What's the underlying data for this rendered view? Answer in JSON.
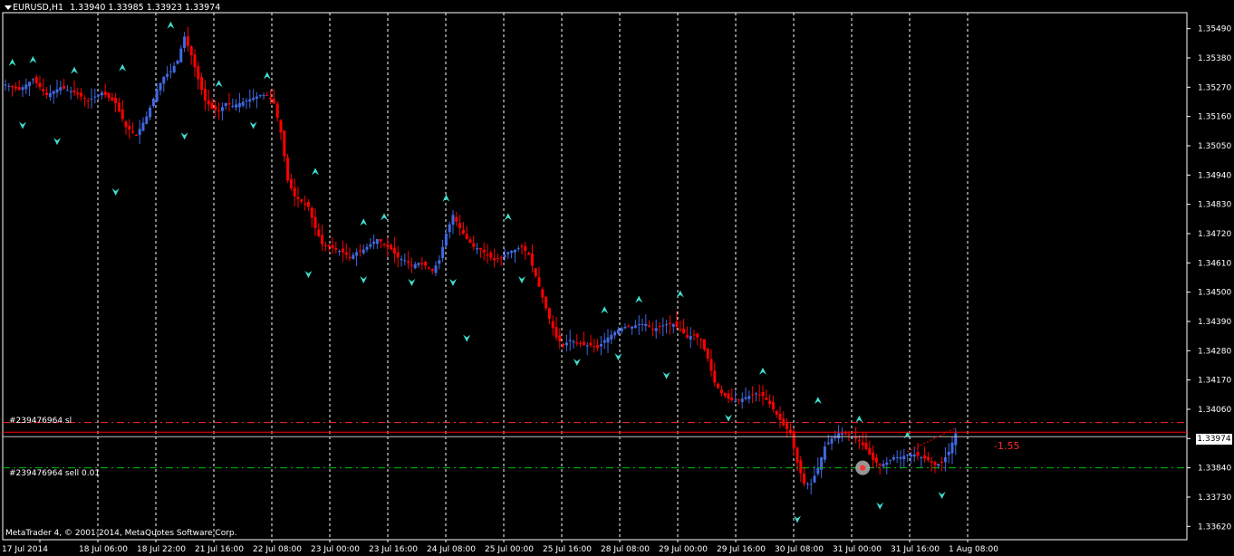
{
  "header": {
    "symbol": "EURUSD,H1",
    "ohlc": "1.33940 1.33985 1.33923 1.33974"
  },
  "copyright": "MetaTrader 4, © 2001-2014, MetaQuotes Software Corp.",
  "orders": {
    "sl_label": "#239476964 sl",
    "sell_label": "#239476964 sell 0.01",
    "sl_price": 1.3401,
    "sell_price": 1.3384,
    "profit": "-1.55"
  },
  "current_price": {
    "label": "1.33974",
    "value": 1.33974
  },
  "colors": {
    "bull": "#4169e1",
    "bear": "#ff0000",
    "fractal": "#40e0d0",
    "grid": "#ffffff",
    "sl_line": "#ff2a2a",
    "sell_line": "#00c000",
    "price_line": "#ff0000"
  },
  "chart_data": {
    "type": "candlestick",
    "title": "",
    "ylim": [
      1.3357,
      1.3555
    ],
    "y_ticks": [
      "1.35490",
      "1.35380",
      "1.35270",
      "1.35160",
      "1.35050",
      "1.34940",
      "1.34830",
      "1.34720",
      "1.34610",
      "1.34500",
      "1.34390",
      "1.34280",
      "1.34170",
      "1.34060",
      "1.33950",
      "1.33840",
      "1.33730",
      "1.33620"
    ],
    "x_ticks": [
      "17 Jul 2014",
      "18 Jul 06:00",
      "18 Jul 22:00",
      "21 Jul 16:00",
      "22 Jul 08:00",
      "23 Jul 00:00",
      "23 Jul 16:00",
      "24 Jul 08:00",
      "25 Jul 00:00",
      "25 Jul 16:00",
      "28 Jul 08:00",
      "29 Jul 00:00",
      "29 Jul 16:00",
      "30 Jul 08:00",
      "31 Jul 00:00",
      "31 Jul 16:00",
      "1 Aug 08:00"
    ],
    "close_path": [
      [
        0,
        1.3528
      ],
      [
        4,
        1.3526
      ],
      [
        8,
        1.353
      ],
      [
        12,
        1.3524
      ],
      [
        16,
        1.3527
      ],
      [
        20,
        1.3525
      ],
      [
        24,
        1.3522
      ],
      [
        28,
        1.3525
      ],
      [
        32,
        1.3521
      ],
      [
        35,
        1.3512
      ],
      [
        38,
        1.3509
      ],
      [
        41,
        1.3516
      ],
      [
        44,
        1.3526
      ],
      [
        46,
        1.3531
      ],
      [
        48,
        1.3533
      ],
      [
        50,
        1.3537
      ],
      [
        52,
        1.3546
      ],
      [
        54,
        1.3539
      ],
      [
        56,
        1.353
      ],
      [
        58,
        1.3522
      ],
      [
        60,
        1.3519
      ],
      [
        62,
        1.3518
      ],
      [
        64,
        1.3521
      ],
      [
        66,
        1.352
      ],
      [
        68,
        1.3521
      ],
      [
        70,
        1.3522
      ],
      [
        72,
        1.3523
      ],
      [
        74,
        1.3524
      ],
      [
        76,
        1.3524
      ],
      [
        78,
        1.3521
      ],
      [
        80,
        1.351
      ],
      [
        82,
        1.3492
      ],
      [
        84,
        1.3486
      ],
      [
        86,
        1.3484
      ],
      [
        88,
        1.3482
      ],
      [
        90,
        1.3474
      ],
      [
        92,
        1.3468
      ],
      [
        94,
        1.3467
      ],
      [
        96,
        1.3466
      ],
      [
        98,
        1.3465
      ],
      [
        100,
        1.3463
      ],
      [
        102,
        1.3465
      ],
      [
        104,
        1.3466
      ],
      [
        106,
        1.3468
      ],
      [
        108,
        1.347
      ],
      [
        110,
        1.3468
      ],
      [
        112,
        1.3466
      ],
      [
        114,
        1.3463
      ],
      [
        116,
        1.3462
      ],
      [
        118,
        1.346
      ],
      [
        120,
        1.3461
      ],
      [
        122,
        1.346
      ],
      [
        124,
        1.3458
      ],
      [
        126,
        1.3462
      ],
      [
        128,
        1.3472
      ],
      [
        130,
        1.3479
      ],
      [
        132,
        1.3474
      ],
      [
        134,
        1.347
      ],
      [
        136,
        1.3467
      ],
      [
        138,
        1.3466
      ],
      [
        140,
        1.3464
      ],
      [
        142,
        1.3462
      ],
      [
        144,
        1.3463
      ],
      [
        146,
        1.3465
      ],
      [
        148,
        1.3466
      ],
      [
        150,
        1.3467
      ],
      [
        152,
        1.3464
      ],
      [
        154,
        1.3456
      ],
      [
        156,
        1.3448
      ],
      [
        158,
        1.344
      ],
      [
        160,
        1.3433
      ],
      [
        162,
        1.343
      ],
      [
        164,
        1.3432
      ],
      [
        166,
        1.3431
      ],
      [
        168,
        1.343
      ],
      [
        170,
        1.343
      ],
      [
        172,
        1.3429
      ],
      [
        174,
        1.3432
      ],
      [
        176,
        1.3434
      ],
      [
        178,
        1.3436
      ],
      [
        180,
        1.3437
      ],
      [
        182,
        1.3437
      ],
      [
        184,
        1.3438
      ],
      [
        186,
        1.3438
      ],
      [
        188,
        1.3436
      ],
      [
        190,
        1.3437
      ],
      [
        192,
        1.3438
      ],
      [
        194,
        1.3438
      ],
      [
        196,
        1.3436
      ],
      [
        198,
        1.3433
      ],
      [
        200,
        1.3434
      ],
      [
        202,
        1.3432
      ],
      [
        204,
        1.3425
      ],
      [
        206,
        1.3416
      ],
      [
        208,
        1.3412
      ],
      [
        210,
        1.341
      ],
      [
        212,
        1.3409
      ],
      [
        214,
        1.341
      ],
      [
        216,
        1.3411
      ],
      [
        218,
        1.3412
      ],
      [
        220,
        1.3411
      ],
      [
        222,
        1.3408
      ],
      [
        224,
        1.3404
      ],
      [
        226,
        1.34
      ],
      [
        228,
        1.3397
      ],
      [
        230,
        1.3386
      ],
      [
        232,
        1.3378
      ],
      [
        234,
        1.3378
      ],
      [
        236,
        1.3384
      ],
      [
        238,
        1.3392
      ],
      [
        240,
        1.3395
      ],
      [
        242,
        1.3397
      ],
      [
        244,
        1.3397
      ],
      [
        246,
        1.3396
      ],
      [
        248,
        1.3394
      ],
      [
        250,
        1.3391
      ],
      [
        252,
        1.3387
      ],
      [
        254,
        1.3385
      ],
      [
        256,
        1.3386
      ],
      [
        258,
        1.3388
      ],
      [
        260,
        1.3388
      ],
      [
        262,
        1.3389
      ],
      [
        264,
        1.3389
      ],
      [
        266,
        1.3388
      ],
      [
        268,
        1.3387
      ],
      [
        270,
        1.3385
      ],
      [
        272,
        1.3386
      ],
      [
        274,
        1.339
      ],
      [
        276,
        1.3397
      ]
    ],
    "fractals": [
      [
        2,
        1.3536,
        "up"
      ],
      [
        8,
        1.3537,
        "up"
      ],
      [
        20,
        1.3533,
        "up"
      ],
      [
        34,
        1.3534,
        "up"
      ],
      [
        48,
        1.355,
        "up"
      ],
      [
        62,
        1.3528,
        "up"
      ],
      [
        76,
        1.3531,
        "up"
      ],
      [
        90,
        1.3495,
        "up"
      ],
      [
        104,
        1.3476,
        "up"
      ],
      [
        110,
        1.3478,
        "up"
      ],
      [
        128,
        1.3485,
        "up"
      ],
      [
        146,
        1.3478,
        "up"
      ],
      [
        174,
        1.3443,
        "up"
      ],
      [
        184,
        1.3447,
        "up"
      ],
      [
        196,
        1.3449,
        "up"
      ],
      [
        220,
        1.342,
        "up"
      ],
      [
        236,
        1.3409,
        "up"
      ],
      [
        248,
        1.3402,
        "up"
      ],
      [
        262,
        1.3396,
        "up"
      ],
      [
        5,
        1.3513,
        "down"
      ],
      [
        15,
        1.3507,
        "down"
      ],
      [
        32,
        1.3488,
        "down"
      ],
      [
        52,
        1.3509,
        "down"
      ],
      [
        72,
        1.3513,
        "down"
      ],
      [
        88,
        1.3457,
        "down"
      ],
      [
        104,
        1.3455,
        "down"
      ],
      [
        118,
        1.3454,
        "down"
      ],
      [
        130,
        1.3454,
        "down"
      ],
      [
        134,
        1.3433,
        "down"
      ],
      [
        150,
        1.3455,
        "down"
      ],
      [
        166,
        1.3424,
        "down"
      ],
      [
        178,
        1.3426,
        "down"
      ],
      [
        192,
        1.3419,
        "down"
      ],
      [
        210,
        1.3403,
        "down"
      ],
      [
        230,
        1.3365,
        "down"
      ],
      [
        254,
        1.337,
        "down"
      ],
      [
        272,
        1.3374,
        "down"
      ]
    ]
  }
}
